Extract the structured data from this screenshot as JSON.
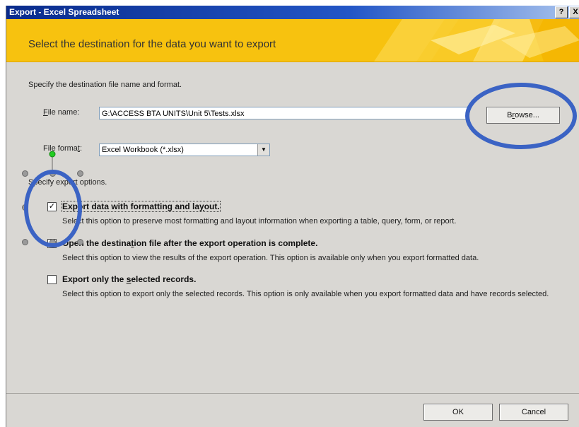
{
  "window": {
    "title": "Export - Excel Spreadsheet",
    "help_glyph": "?",
    "close_glyph": "X"
  },
  "banner": {
    "heading": "Select the destination for the data you want to export"
  },
  "intro": "Specify the destination file name and format.",
  "file_name": {
    "label_key": "F",
    "label_rest": "ile name:",
    "value": "G:\\ACCESS BTA UNITS\\Unit 5\\Tests.xlsx"
  },
  "browse": {
    "pre": "B",
    "key": "r",
    "post": "owse..."
  },
  "file_format": {
    "pre": "File forma",
    "key": "t",
    "post": ":",
    "value": "Excel Workbook (*.xlsx)"
  },
  "options_label": "Specify export options.",
  "options": [
    {
      "checked": true,
      "pre": "Export data with formatting and la",
      "key": "y",
      "post": "out.",
      "desc": "Select this option to preserve most formatting and layout information when exporting a table, query, form, or report."
    },
    {
      "checked": false,
      "pre": "Open the destina",
      "key": "t",
      "post": "ion file after the export operation is complete.",
      "desc": "Select this option to view the results of the export operation. This option is available only when you export formatted data."
    },
    {
      "checked": false,
      "pre": "Export only the ",
      "key": "s",
      "post": "elected records.",
      "desc": "Select this option to export only the selected records. This option is only available when you export formatted data and have records selected."
    }
  ],
  "buttons": {
    "ok": "OK",
    "cancel": "Cancel"
  },
  "colors": {
    "banner": "#f7c20f",
    "annotation": "#3b63c4",
    "title_bar": "#0a2c8c"
  }
}
